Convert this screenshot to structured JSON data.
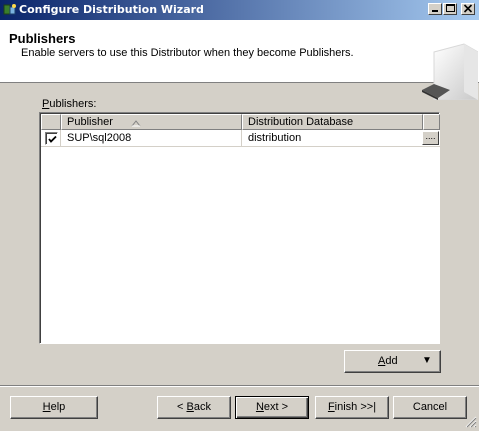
{
  "window": {
    "title": "Configure Distribution Wizard",
    "icon": "wizard-icon",
    "controls": {
      "minimize": "minimize-icon",
      "maximize": "maximize-icon",
      "close": "close-icon"
    }
  },
  "header": {
    "title": "Publishers",
    "subtitle": "Enable servers to use this Distributor when they become Publishers.",
    "graphic": "server-graphic"
  },
  "publishers": {
    "label_prefix": "",
    "label_mnemonic": "P",
    "label_rest": "ublishers:",
    "columns": [
      {
        "label": ""
      },
      {
        "label": "Publisher",
        "sort": "ascending"
      },
      {
        "label": "Distribution Database"
      },
      {
        "label": ""
      }
    ],
    "rows": [
      {
        "checked": true,
        "publisher": "SUP\\sql2008",
        "database": "distribution",
        "ellipsis": "...."
      }
    ]
  },
  "add_button": {
    "mnemonic": "A",
    "rest": "dd",
    "arrow": "▼"
  },
  "footer": {
    "help": {
      "mnemonic": "H",
      "rest": "elp"
    },
    "back": {
      "prefix": "< ",
      "mnemonic": "B",
      "rest": "ack"
    },
    "next": {
      "mnemonic": "N",
      "rest": "ext >"
    },
    "finish": {
      "mnemonic": "F",
      "rest": "inish >>|"
    },
    "cancel": {
      "label": "Cancel"
    }
  }
}
